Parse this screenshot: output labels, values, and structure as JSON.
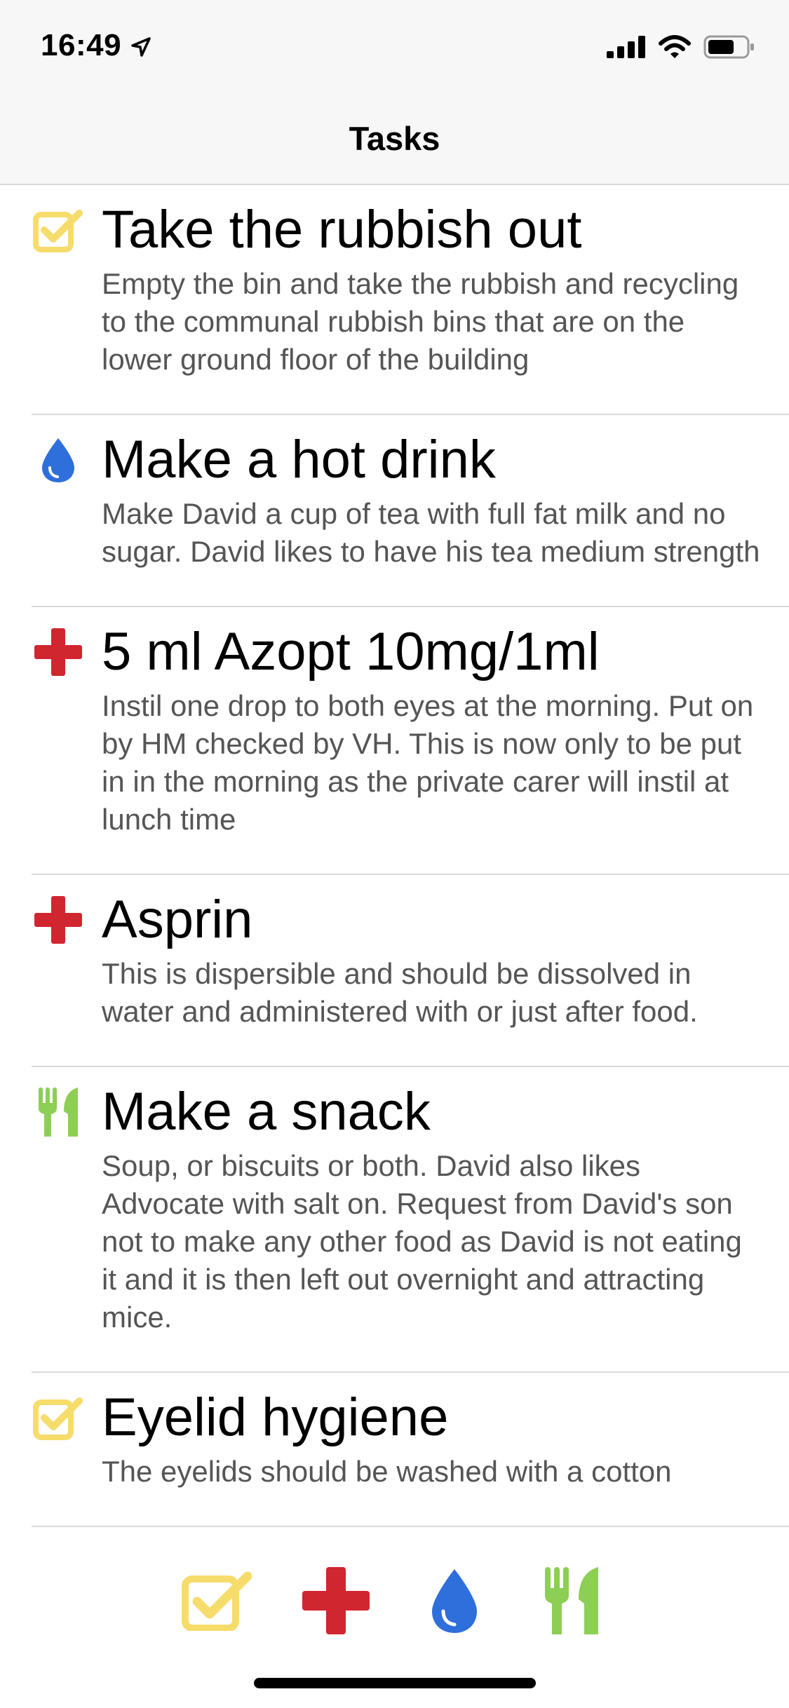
{
  "status_bar": {
    "time": "16:49"
  },
  "nav": {
    "title": "Tasks"
  },
  "colors": {
    "checklist": "#f6dc6b",
    "medical": "#d0262f",
    "drink": "#2f6fdb",
    "food": "#8ccf54",
    "description": "#555555"
  },
  "tasks": [
    {
      "icon": "checklist-icon",
      "title": "Take the rubbish out",
      "description": "Empty the bin and take the rubbish and recycling to the communal rubbish bins that are on the lower ground floor of the building"
    },
    {
      "icon": "water-drop-icon",
      "title": "Make a hot drink",
      "description": "Make David a cup of tea with full fat milk  and no sugar.  David likes to have his tea medium strength"
    },
    {
      "icon": "medical-cross-icon",
      "title": "5 ml Azopt 10mg/1ml",
      "description": "Instil one drop to both eyes at the morning. Put on by HM checked by VH. This is now only to be put in in the morning as the private carer will instil at lunch time"
    },
    {
      "icon": "medical-cross-icon",
      "title": "Asprin",
      "description": "This is dispersible and should be dissolved in water and administered with or just after food."
    },
    {
      "icon": "fork-knife-icon",
      "title": "Make a snack",
      "description": "Soup, or biscuits or both. David also likes Advocate with salt on.  Request from David's son not to make any other food as David is not eating it and it is then left out overnight and attracting mice."
    },
    {
      "icon": "checklist-icon",
      "title": "Eyelid hygiene",
      "description": "The eyelids should be washed with a cotton"
    }
  ],
  "filters": [
    {
      "icon": "checklist-icon"
    },
    {
      "icon": "medical-cross-icon"
    },
    {
      "icon": "water-drop-icon"
    },
    {
      "icon": "fork-knife-icon"
    }
  ]
}
